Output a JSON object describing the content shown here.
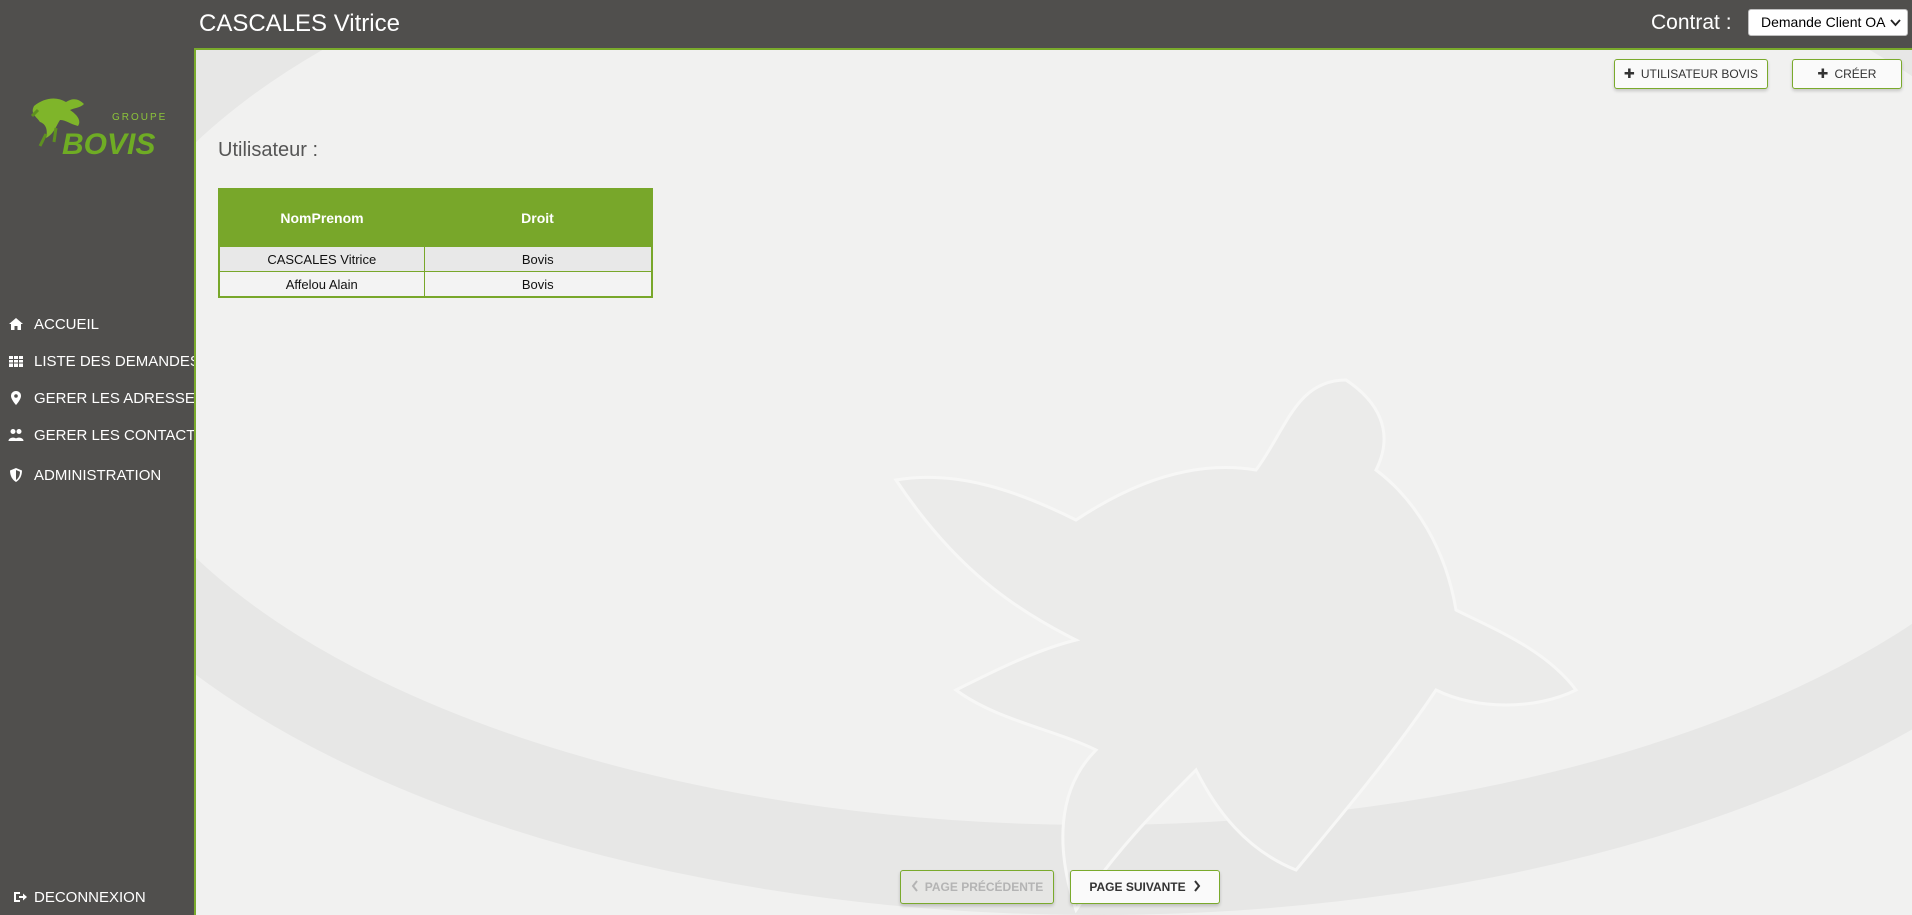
{
  "header": {
    "title": "CASCALES Vitrice",
    "contract_label": "Contrat :",
    "contract_selected": "Demande Client OA"
  },
  "logo": {
    "brand_top": "GROUPE",
    "brand_main": "BOVIS"
  },
  "sidebar": {
    "items": [
      {
        "label": "ACCUEIL",
        "icon": "home-icon"
      },
      {
        "label": "LISTE DES DEMANDES",
        "icon": "table-icon"
      },
      {
        "label": "GERER LES ADRESSES",
        "icon": "map-marker-icon"
      },
      {
        "label": "GERER LES CONTACTS",
        "icon": "users-icon"
      },
      {
        "label": "ADMINISTRATION",
        "icon": "shield-icon"
      }
    ],
    "logout": {
      "label": "DECONNEXION",
      "icon": "logout-icon"
    }
  },
  "toolbar": {
    "add_bovis_user_label": "UTILISATEUR BOVIS",
    "create_label": "CRÉER"
  },
  "main": {
    "section_title": "Utilisateur :",
    "table": {
      "columns": [
        "NomPrenom",
        "Droit"
      ],
      "rows": [
        [
          "CASCALES Vitrice",
          "Bovis"
        ],
        [
          "Affelou Alain",
          "Bovis"
        ]
      ]
    }
  },
  "pager": {
    "prev_label": "PAGE PRÉCÉDENTE",
    "next_label": "PAGE SUIVANTE"
  },
  "colors": {
    "accent_green": "#78a72a",
    "sidebar_bg": "#504f4d",
    "content_bg": "#f1f1f0"
  }
}
